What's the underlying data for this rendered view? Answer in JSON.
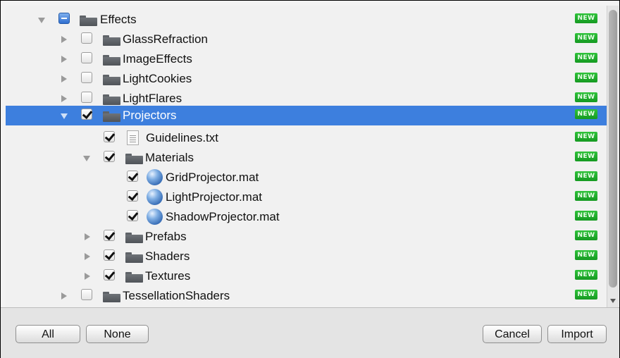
{
  "tree": {
    "rows": [
      {
        "label": "Effects",
        "badge": "NEW"
      },
      {
        "label": "GlassRefraction",
        "badge": "NEW"
      },
      {
        "label": "ImageEffects",
        "badge": "NEW"
      },
      {
        "label": "LightCookies",
        "badge": "NEW"
      },
      {
        "label": "LightFlares",
        "badge": "NEW"
      },
      {
        "label": "Projectors",
        "badge": "NEW"
      },
      {
        "label": "Guidelines.txt",
        "badge": "NEW"
      },
      {
        "label": "Materials",
        "badge": "NEW"
      },
      {
        "label": "GridProjector.mat",
        "badge": "NEW"
      },
      {
        "label": "LightProjector.mat",
        "badge": "NEW"
      },
      {
        "label": "ShadowProjector.mat",
        "badge": "NEW"
      },
      {
        "label": "Prefabs",
        "badge": "NEW"
      },
      {
        "label": "Shaders",
        "badge": "NEW"
      },
      {
        "label": "Textures",
        "badge": "NEW"
      },
      {
        "label": "TessellationShaders",
        "badge": "NEW"
      }
    ]
  },
  "buttons": {
    "all": "All",
    "none": "None",
    "cancel": "Cancel",
    "import": "Import"
  },
  "colors": {
    "selection": "#3d7fde",
    "new_badge": "#1fae2b"
  }
}
